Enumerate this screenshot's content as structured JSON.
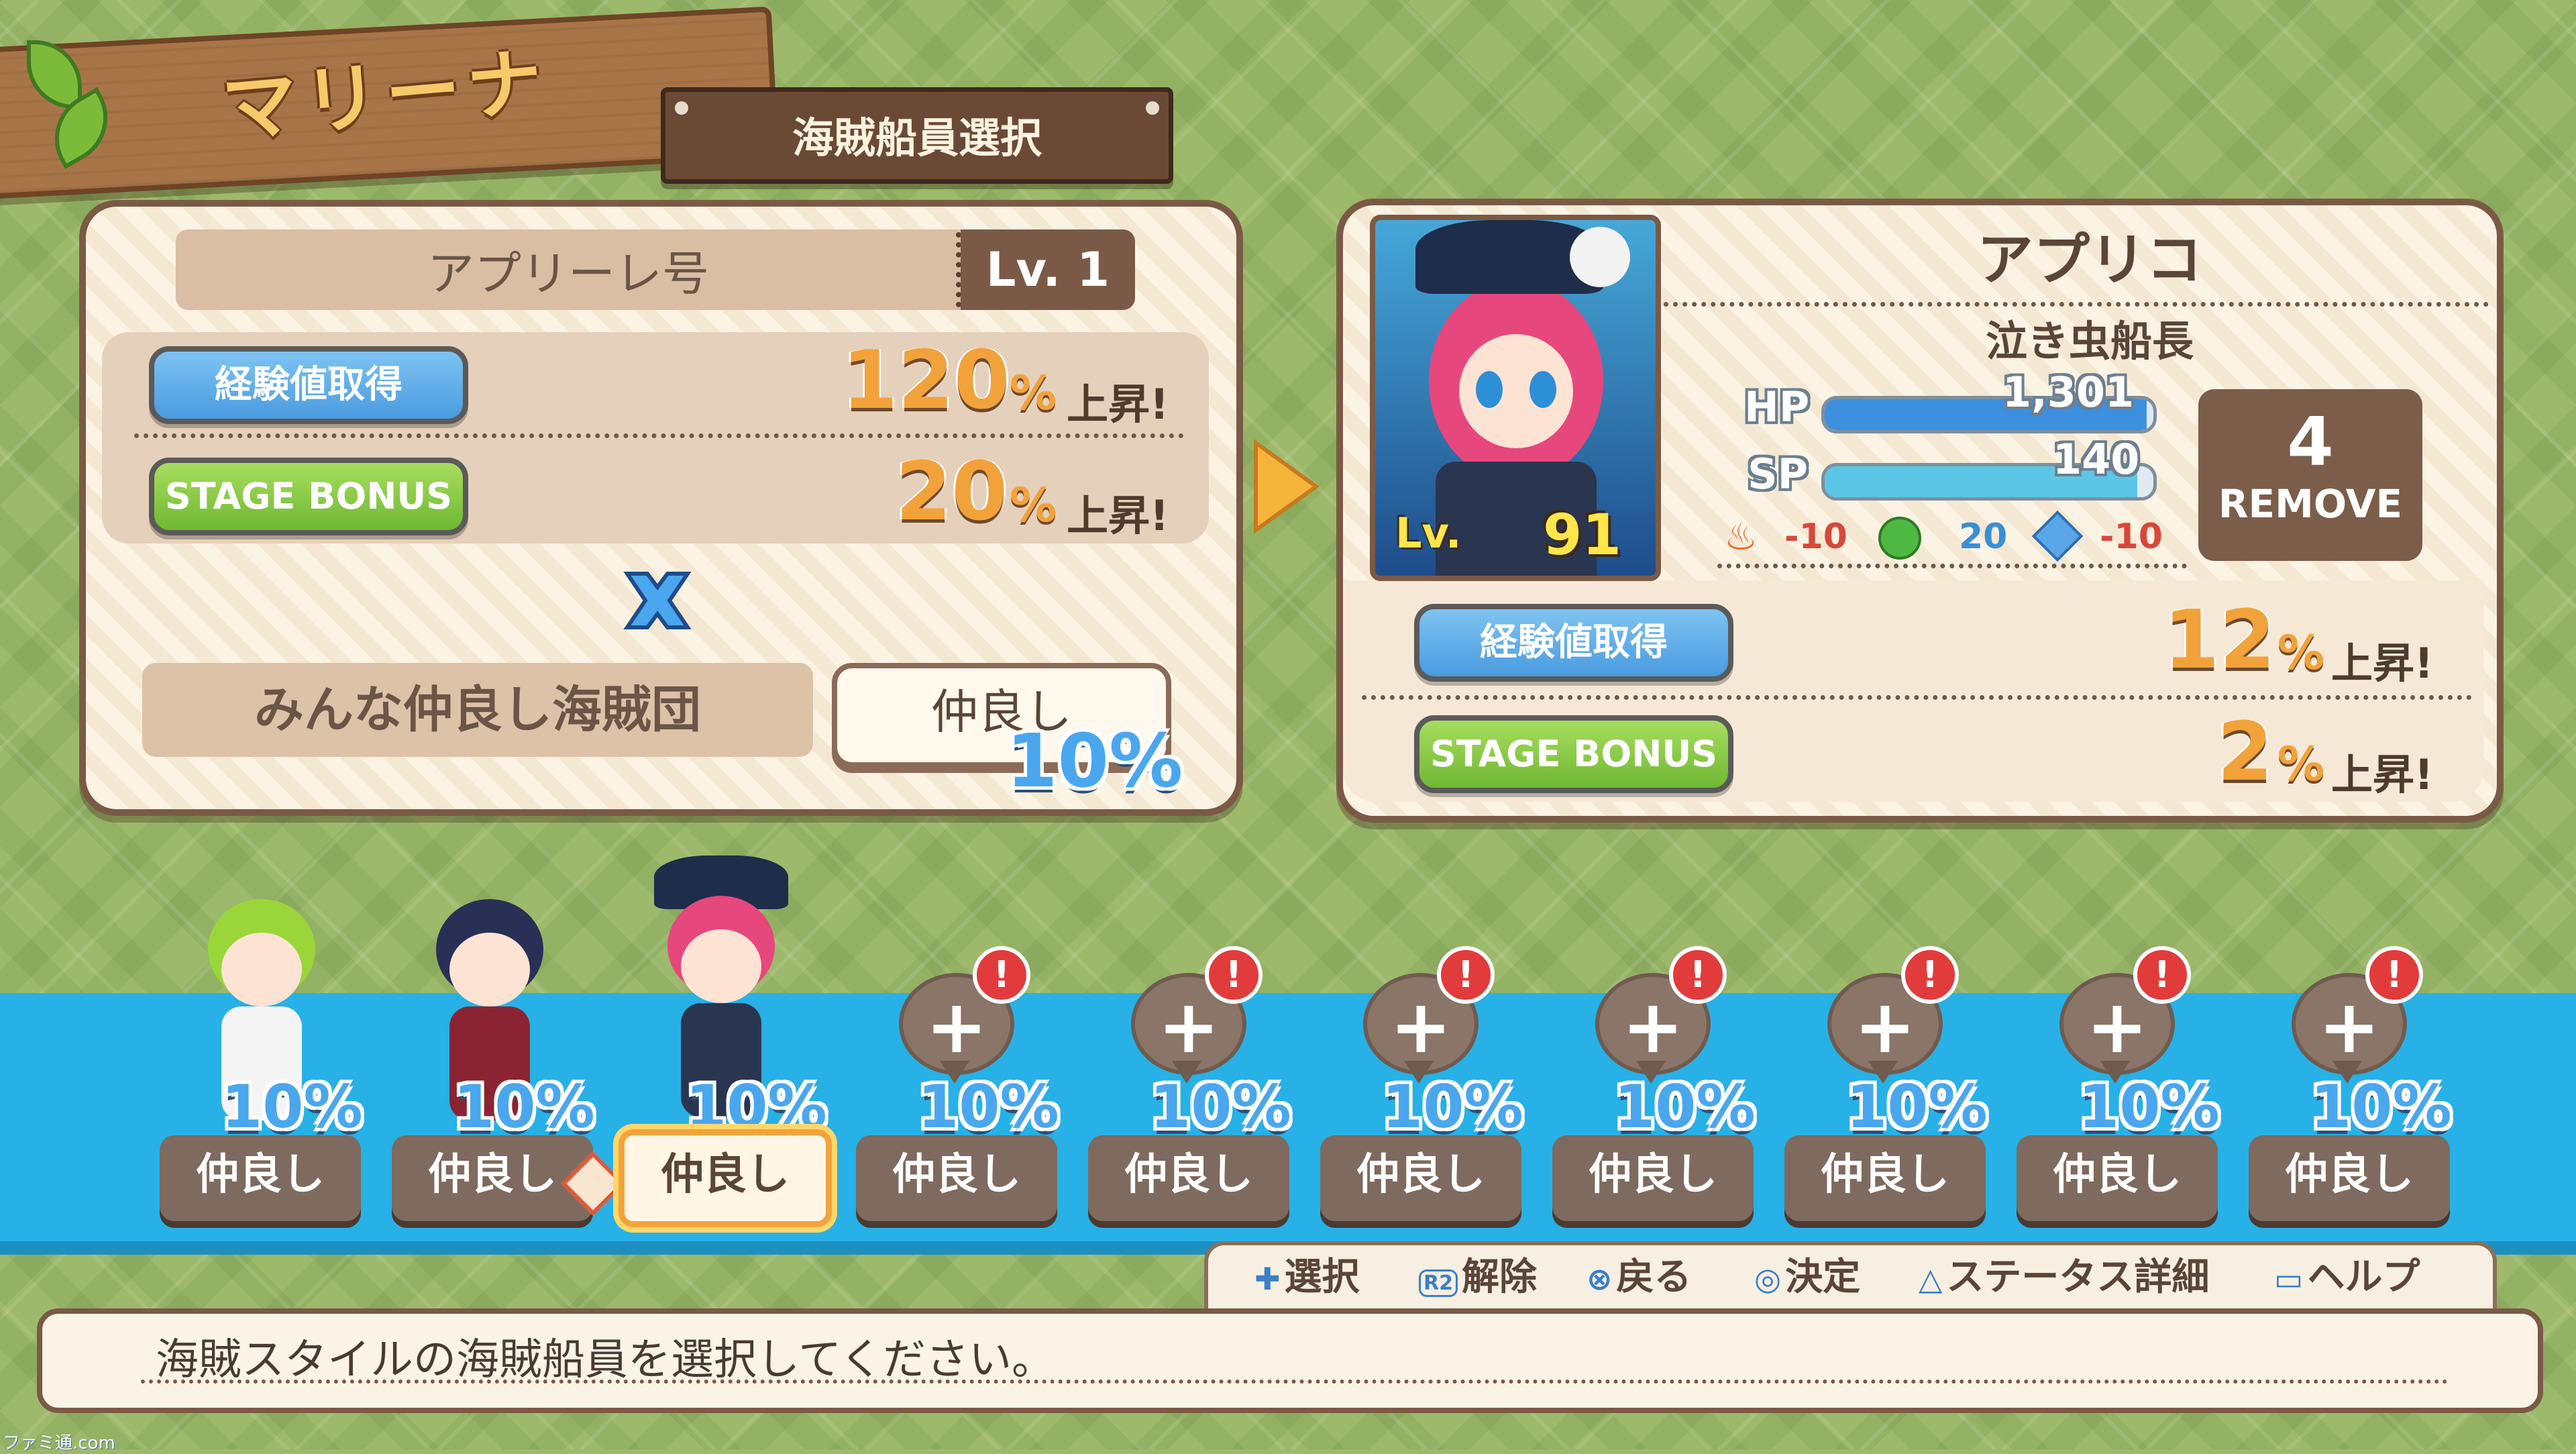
{
  "header": {
    "character_name": "マリーナ",
    "screen_title": "海賊船員選択"
  },
  "ship_panel": {
    "ship_name": "アプリーレ号",
    "level": "Lv. 1",
    "exp_label": "経験値取得",
    "exp_pct": "120",
    "stage_label": "STAGE BONUS",
    "stage_pct": "20",
    "pct_sign": "%",
    "rise_text": "上昇!",
    "multiply_icon": "cross-icon",
    "crew_group_name": "みんな仲良し海賊団",
    "friendship_label": "仲良し",
    "friendship_pct": "10%"
  },
  "character_panel": {
    "name": "アプリコ",
    "title": "泣き虫船長",
    "level_label": "Lv.",
    "level_value": "91",
    "hp_label": "HP",
    "hp_value": "1,301",
    "hp_fill": 0.98,
    "sp_label": "SP",
    "sp_value": "140",
    "sp_fill": 0.95,
    "fire_value": "-10",
    "wind_value": "20",
    "ice_value": "-10",
    "remove_count": "4",
    "remove_label": "REMOVE",
    "exp_label": "経験値取得",
    "exp_pct": "12",
    "stage_label": "STAGE BONUS",
    "stage_pct": "2",
    "pct_sign": "%",
    "rise_text": "上昇!"
  },
  "crew_slots": [
    {
      "label": "仲良し",
      "pct": "10%",
      "state": "filled"
    },
    {
      "label": "仲良し",
      "pct": "10%",
      "state": "filled"
    },
    {
      "label": "仲良し",
      "pct": "10%",
      "state": "selected"
    },
    {
      "label": "仲良し",
      "pct": "10%",
      "state": "empty",
      "alert": "!"
    },
    {
      "label": "仲良し",
      "pct": "10%",
      "state": "empty",
      "alert": "!"
    },
    {
      "label": "仲良し",
      "pct": "10%",
      "state": "empty",
      "alert": "!"
    },
    {
      "label": "仲良し",
      "pct": "10%",
      "state": "empty",
      "alert": "!"
    },
    {
      "label": "仲良し",
      "pct": "10%",
      "state": "empty",
      "alert": "!"
    },
    {
      "label": "仲良し",
      "pct": "10%",
      "state": "empty",
      "alert": "!"
    },
    {
      "label": "仲良し",
      "pct": "10%",
      "state": "empty",
      "alert": "!"
    }
  ],
  "help_bar": {
    "select": "選択",
    "release": "解除",
    "back": "戻る",
    "confirm": "決定",
    "status": "ステータス詳細",
    "help": "ヘルプ",
    "r2": "R2"
  },
  "message": "海賊スタイルの海賊船員を選択してください。",
  "watermark": "ファミ通.com",
  "colors": {
    "accent_orange": "#f2a23a",
    "accent_blue": "#4aa7ee",
    "frame_brown": "#7a5a45",
    "strip_blue": "#27b1e6"
  }
}
